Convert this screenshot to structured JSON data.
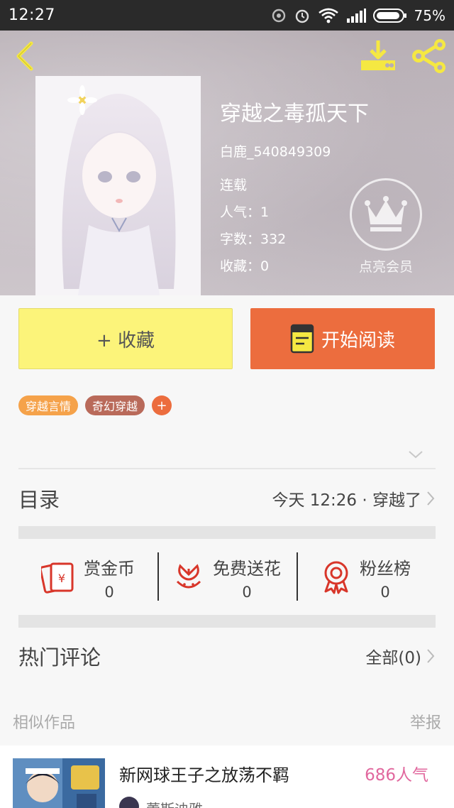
{
  "status_bar": {
    "time": "12:27",
    "battery": "75%"
  },
  "book": {
    "title": "穿越之毒孤天下",
    "author": "白鹿_540849309",
    "status": "连载",
    "popularity": "人气：1",
    "word_count": "字数：332",
    "favorites": "收藏：0"
  },
  "vip": {
    "label": "点亮会员"
  },
  "actions": {
    "favorite_label": "+ 收藏",
    "read_label": "开始阅读"
  },
  "tags": [
    {
      "label": "穿越言情",
      "color": "#f5a24a"
    },
    {
      "label": "奇幻穿越",
      "color": "#b96a5a"
    }
  ],
  "tag_add_label": "+",
  "catalog": {
    "title": "目录",
    "latest": "今天 12:26 · 穿越了"
  },
  "stats": [
    {
      "label": "赏金币",
      "value": "0",
      "icon": "red-envelope-icon"
    },
    {
      "label": "免费送花",
      "value": "0",
      "icon": "flower-icon"
    },
    {
      "label": "粉丝榜",
      "value": "0",
      "icon": "medal-icon"
    }
  ],
  "comments": {
    "title": "热门评论",
    "all": "全部(0)"
  },
  "similar": {
    "heading": "相似作品",
    "report": "举报",
    "items": [
      {
        "title": "新网球王子之放荡不羁",
        "popularity": "686人气",
        "author": "蕾斯迪雅"
      }
    ]
  },
  "colors": {
    "accent": "#ec6d3e",
    "favorite_button": "#fcf47a",
    "popularity": "#e1689e"
  }
}
